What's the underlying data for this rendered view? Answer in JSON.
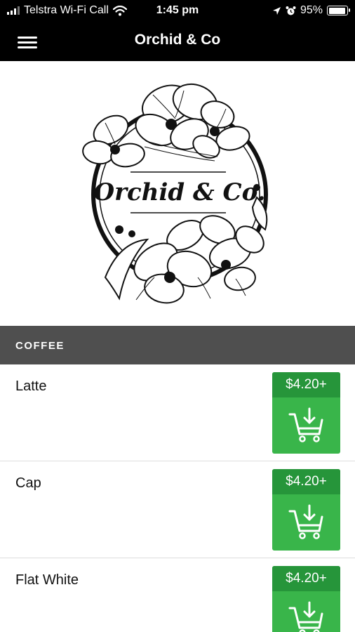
{
  "status_bar": {
    "carrier": "Telstra Wi-Fi Call",
    "time": "1:45 pm",
    "battery": "95%",
    "battery_level": 0.95
  },
  "app_bar": {
    "title": "Orchid & Co",
    "menu_icon": "hamburger-menu-icon"
  },
  "logo": {
    "text": "Orchid & Co."
  },
  "section": {
    "title": "COFFEE"
  },
  "items": [
    {
      "name": "Latte",
      "price": "$4.20+",
      "icon": "add-to-cart-icon"
    },
    {
      "name": "Cap",
      "price": "$4.20+",
      "icon": "add-to-cart-icon"
    },
    {
      "name": "Flat White",
      "price": "$4.20+",
      "icon": "add-to-cart-icon"
    }
  ],
  "colors": {
    "bar_background": "#000000",
    "section_background": "#4f4f4f",
    "button_green": "#39b54a",
    "price_green": "#26953a"
  }
}
